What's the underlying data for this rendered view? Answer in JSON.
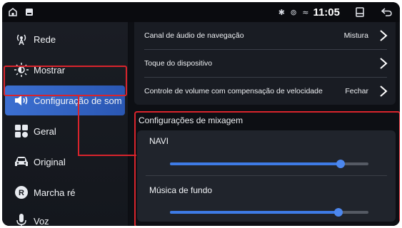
{
  "status_bar": {
    "icons": [
      "home-icon",
      "notification-icon",
      "bluetooth-icon",
      "location-icon",
      "wifi-icon",
      "recent-apps-icon",
      "back-icon"
    ],
    "bt_loc_wifi": "✱ ⊚ ≈",
    "time": "11:05"
  },
  "sidebar": {
    "items": [
      {
        "label": "Rede",
        "icon": "antenna-icon"
      },
      {
        "label": "Mostrar",
        "icon": "brightness-icon"
      },
      {
        "label": "Configuração de som",
        "icon": "speaker-icon",
        "active": true
      },
      {
        "label": "Geral",
        "icon": "grid-icon"
      },
      {
        "label": "Original",
        "icon": "car-icon"
      },
      {
        "label": "Marcha ré",
        "icon": "reverse-icon"
      },
      {
        "label": "Voz",
        "icon": "microphone-icon"
      }
    ]
  },
  "settings": {
    "rows": [
      {
        "label": "Canal de áudio de navegação",
        "value": "Mistura"
      },
      {
        "label": "Toque do dispositivo",
        "value": ""
      },
      {
        "label": "Controle de volume com compensação de velocidade",
        "value": "Fechar"
      }
    ]
  },
  "mixing": {
    "title": "Configurações de mixagem",
    "sliders": [
      {
        "label": "NAVI",
        "level": 0.86
      },
      {
        "label": "Música de fundo",
        "level": 0.85
      }
    ]
  },
  "colors": {
    "accent": "#3e7be6",
    "highlight": "#d9242c",
    "active_item": "#3c6fd0"
  }
}
